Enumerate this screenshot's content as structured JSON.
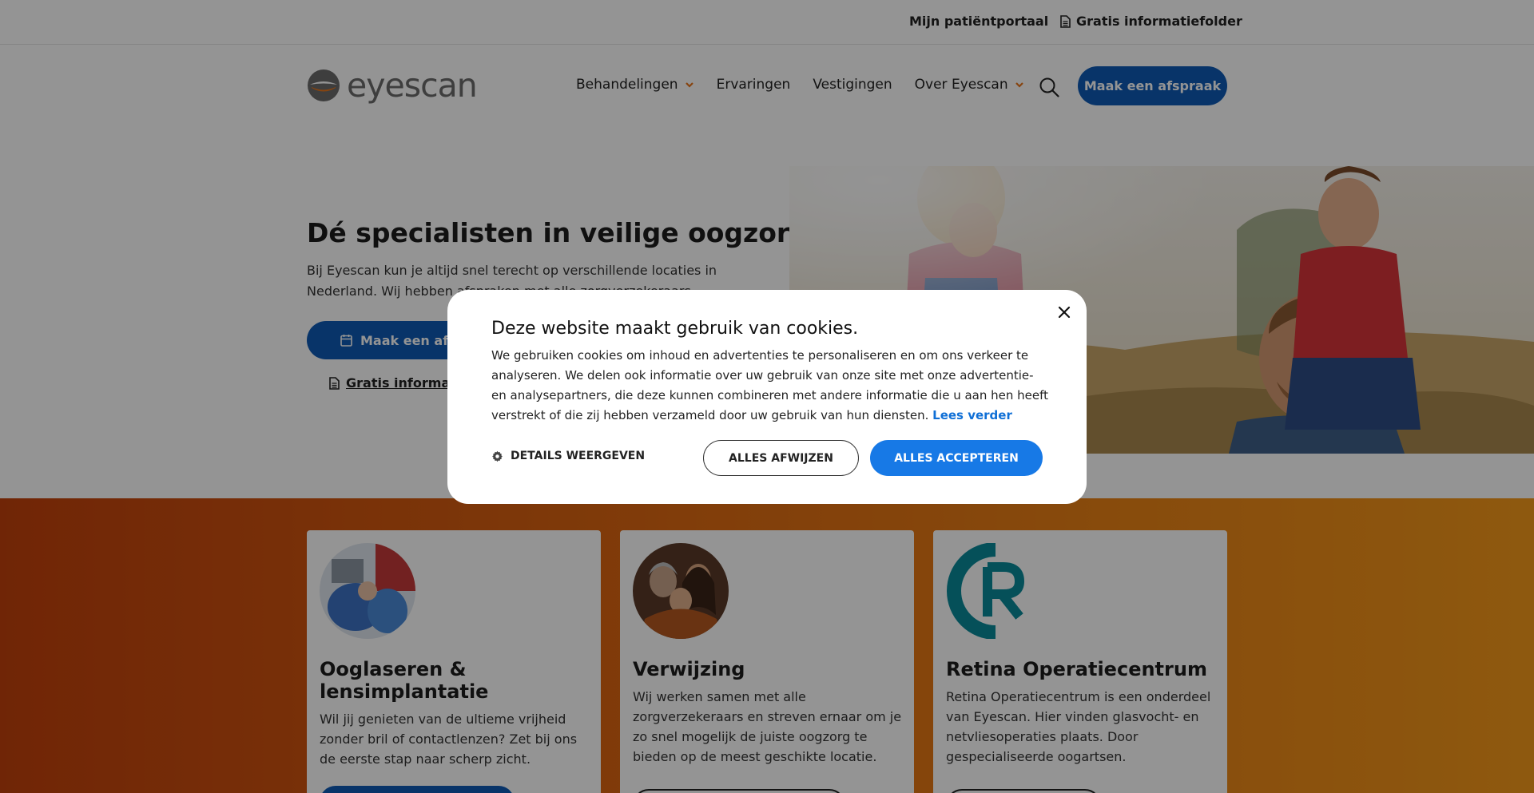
{
  "topbar": {
    "portal_label": "Mijn patiëntportaal",
    "folder_label": "Gratis informatiefolder"
  },
  "header": {
    "logo_text": "eyescan",
    "nav": [
      {
        "label": "Behandelingen",
        "has_dropdown": true
      },
      {
        "label": "Ervaringen",
        "has_dropdown": false
      },
      {
        "label": "Vestigingen",
        "has_dropdown": false
      },
      {
        "label": "Over Eyescan",
        "has_dropdown": true
      }
    ],
    "cta_label": "Maak een afspraak"
  },
  "hero": {
    "title": "Dé specialisten in veilige oogzorg",
    "intro": "Bij Eyescan kun je altijd snel terecht op verschillende locaties in Nederland. Wij hebben afspraken met alle zorgverzekeraars.",
    "primary_button": "Maak een afspraak",
    "secondary_link": "Gratis informatiefolder"
  },
  "cards": [
    {
      "title": "Ooglaseren & lensimplantatie",
      "text": "Wil jij genieten van de ultieme vrijheid zonder bril of contactlenzen?  Zet bij ons de eerste stap naar scherp zicht."
    },
    {
      "title": "Verwijzing",
      "text": "Wij werken samen met alle zorgverzekeraars en streven ernaar om je zo snel mogelijk de juiste oogzorg te bieden op de meest geschikte locatie."
    },
    {
      "title": "Retina Operatiecentrum",
      "text": "Retina Operatiecentrum is een onderdeel van Eyescan. Hier vinden glasvocht- en netvliesoperaties plaats. Door gespecialiseerde oogartsen."
    }
  ],
  "cookie": {
    "title": "Deze website maakt gebruik van cookies.",
    "text": "We gebruiken cookies om inhoud en advertenties te personaliseren en om ons verkeer te analyseren. We delen ook informatie over uw gebruik van onze site met onze advertentie- en analysepartners, die deze kunnen combineren met andere informatie die u aan hen heeft verstrekt of die zij hebben verzameld door uw gebruik van hun diensten.",
    "read_more": "Lees verder",
    "details_label": "DETAILS WEERGEVEN",
    "reject_label": "ALLES AFWIJZEN",
    "accept_label": "ALLES ACCEPTEREN"
  },
  "colors": {
    "brand_blue": "#0f5bb5",
    "accept_blue": "#1779e6",
    "accent_orange": "#e8751a",
    "retina_teal": "#0a8a9a"
  },
  "icons": [
    "document-icon",
    "chevron-down-icon",
    "search-icon",
    "calendar-icon",
    "gear-icon",
    "close-icon",
    "eyescan-logo-icon",
    "retina-logo"
  ]
}
